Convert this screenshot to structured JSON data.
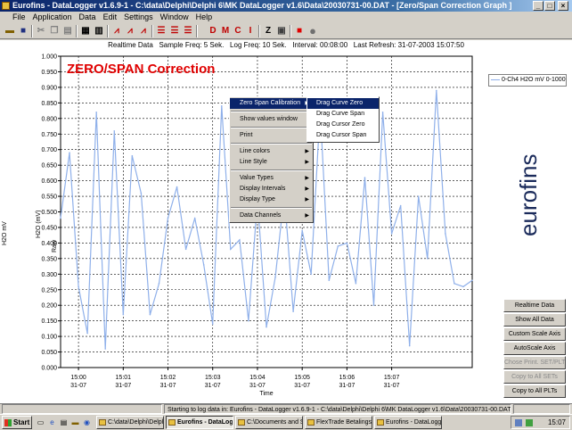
{
  "window": {
    "title": "Eurofins - DataLogger v1.6.9-1 - C:\\data\\Delphi\\Delphi 6\\MK DataLogger v1.6\\Data\\20030731-00.DAT - [Zero/Span Correction Graph ]"
  },
  "menu": [
    "File",
    "Application",
    "Data",
    "Edit",
    "Settings",
    "Window",
    "Help"
  ],
  "toolbar": {
    "letter_buttons": [
      "D",
      "M",
      "C",
      "I",
      "Z"
    ]
  },
  "chart_info": "Realtime Data   Sample Freq: 5 Sek.   Log Freq: 10 Sek.   Interval: 00:08:00   Last Refresh: 31-07-2003 15:07:50",
  "chart_title": "ZERO/SPAN Correction",
  "y_labels": {
    "a": "H2O mV",
    "b": "H2O (mV)",
    "c": "Raw"
  },
  "legend": "0-Ch4 H2O mV 0-1000",
  "logo_text": "eurofins",
  "side_buttons": [
    {
      "label": "Realtime Data",
      "enabled": true
    },
    {
      "label": "Show All Data",
      "enabled": true
    },
    {
      "label": "Custom Scale Axis",
      "enabled": true
    },
    {
      "label": "AutoScale Axis",
      "enabled": true
    },
    {
      "label": "Chose Print. SET/PLT",
      "enabled": false
    },
    {
      "label": "Copy to All SETs",
      "enabled": false
    },
    {
      "label": "Copy to All PLTs",
      "enabled": true
    }
  ],
  "context_menu": {
    "groups": [
      [
        {
          "label": "Zero Span Calibration",
          "submenu": true,
          "highlighted": true
        }
      ],
      [
        {
          "label": "Show values window",
          "submenu": false
        }
      ],
      [
        {
          "label": "Print",
          "submenu": false
        }
      ],
      [
        {
          "label": "Line colors",
          "submenu": true
        },
        {
          "label": "Line Style",
          "submenu": true
        }
      ],
      [
        {
          "label": "Value Types",
          "submenu": true
        },
        {
          "label": "Display Intervals",
          "submenu": true
        },
        {
          "label": "Display Type",
          "submenu": true
        }
      ],
      [
        {
          "label": "Data Channels",
          "submenu": true
        }
      ]
    ],
    "submenu": [
      {
        "label": "Drag Curve Zero",
        "highlighted": true
      },
      {
        "label": "Drag Curve Span"
      },
      {
        "label": "Drag Cursor Zero"
      },
      {
        "label": "Drag Cursor Span"
      }
    ]
  },
  "status": {
    "left": "",
    "message": "Starting to log data in: Eurofins - DataLogger v1.6.9-1 - C:\\data\\Delphi\\Delphi 6\\MK DataLogger v1.6\\Data\\20030731-00.DAT",
    "right": ""
  },
  "taskbar": {
    "start": "Start",
    "tasks": [
      {
        "label": "C:\\data\\Delphi\\Delphi 6...",
        "active": false
      },
      {
        "label": "Eurofins - DataLog...",
        "active": true
      },
      {
        "label": "C:\\Documents and Se...",
        "active": false
      },
      {
        "label": "FlexTrade Betalingspo...",
        "active": false
      },
      {
        "label": "Eurofins - DataLogger...",
        "active": false
      }
    ],
    "clock": "15:07"
  },
  "colors": {
    "series": "#8fb0ea",
    "title_red": "#e00000",
    "titlebar": "#0a246a"
  },
  "chart_data": {
    "type": "line",
    "title": "ZERO/SPAN Correction",
    "xlabel": "Time",
    "ylabel": "H2O mV",
    "ylim": [
      0,
      1.0
    ],
    "yticks": [
      "0.000",
      "0.050",
      "0.100",
      "0.150",
      "0.200",
      "0.250",
      "0.300",
      "0.350",
      "0.400",
      "0.450",
      "0.500",
      "0.550",
      "0.600",
      "0.650",
      "0.700",
      "0.750",
      "0.800",
      "0.850",
      "0.900",
      "0.950",
      "1.000"
    ],
    "xlim": [
      14.6,
      23.8
    ],
    "xtick_values": [
      15,
      16,
      17,
      18,
      19,
      20,
      21,
      22
    ],
    "xtick_labels": [
      [
        "15:00",
        "31-07"
      ],
      [
        "15:01",
        "31-07"
      ],
      [
        "15:02",
        "31-07"
      ],
      [
        "15:03",
        "31-07"
      ],
      [
        "15:04",
        "31-07"
      ],
      [
        "15:05",
        "31-07"
      ],
      [
        "15:06",
        "31-07"
      ],
      [
        "15:07",
        "31-07"
      ]
    ],
    "grid": true,
    "series": [
      {
        "name": "0-Ch4 H2O mV 0-1000",
        "x": [
          14.6,
          14.8,
          15,
          15.2,
          15.4,
          15.6,
          15.8,
          16,
          16.2,
          16.4,
          16.6,
          16.8,
          17,
          17.2,
          17.4,
          17.6,
          17.8,
          18,
          18.2,
          18.4,
          18.6,
          18.8,
          19,
          19.2,
          19.4,
          19.6,
          19.8,
          20,
          20.2,
          20.4,
          20.6,
          20.8,
          21,
          21.2,
          21.4,
          21.6,
          21.8,
          22,
          22.2,
          22.4,
          22.6,
          22.8,
          23,
          23.2,
          23.4,
          23.6,
          23.8
        ],
        "y": [
          0.48,
          0.69,
          0.26,
          0.11,
          0.82,
          0.06,
          0.76,
          0.17,
          0.68,
          0.56,
          0.17,
          0.27,
          0.48,
          0.58,
          0.38,
          0.48,
          0.33,
          0.14,
          0.84,
          0.38,
          0.41,
          0.15,
          0.54,
          0.13,
          0.29,
          0.56,
          0.18,
          0.44,
          0.3,
          0.83,
          0.28,
          0.39,
          0.4,
          0.27,
          0.61,
          0.2,
          0.82,
          0.43,
          0.52,
          0.07,
          0.55,
          0.35,
          0.89,
          0.43,
          0.27,
          0.26,
          0.28
        ]
      }
    ]
  }
}
